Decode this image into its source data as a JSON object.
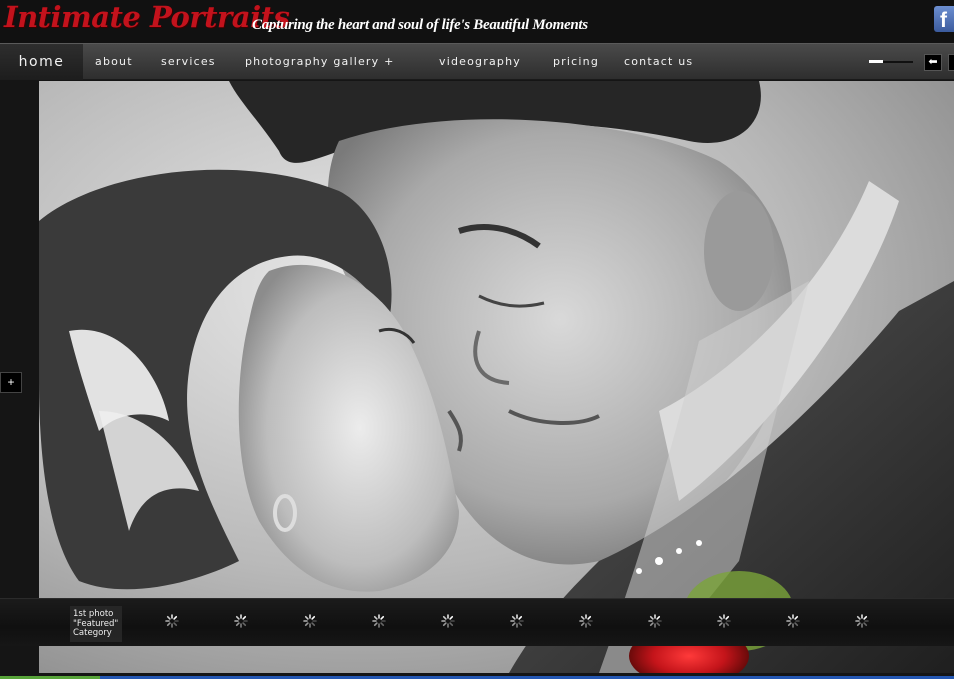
{
  "header": {
    "logo_text": "Intimate Portraits",
    "tagline": "Capturing the heart and soul of life's Beautiful Moments",
    "facebook_icon": "facebook-icon",
    "facebook_glyph": "f"
  },
  "nav": {
    "items": [
      {
        "label": "Home"
      },
      {
        "label": "About"
      },
      {
        "label": "Services"
      },
      {
        "label": "Photography Gallery  +"
      },
      {
        "label": "Videography"
      },
      {
        "label": "Pricing"
      },
      {
        "label": "Contact Us"
      }
    ],
    "prev_icon": "arrow-left-icon",
    "next_icon": "arrow-right-icon",
    "prev_glyph": "⬅"
  },
  "side": {
    "expand_glyph": "+"
  },
  "thumbnails": {
    "first_caption": "1st photo \"Featured\" Category",
    "loading_icon": "loading-spinner-icon"
  },
  "colors": {
    "logo_red": "#c3121c",
    "nav_bg": "#3a3a3a",
    "facebook_blue": "#3b5b9d"
  }
}
